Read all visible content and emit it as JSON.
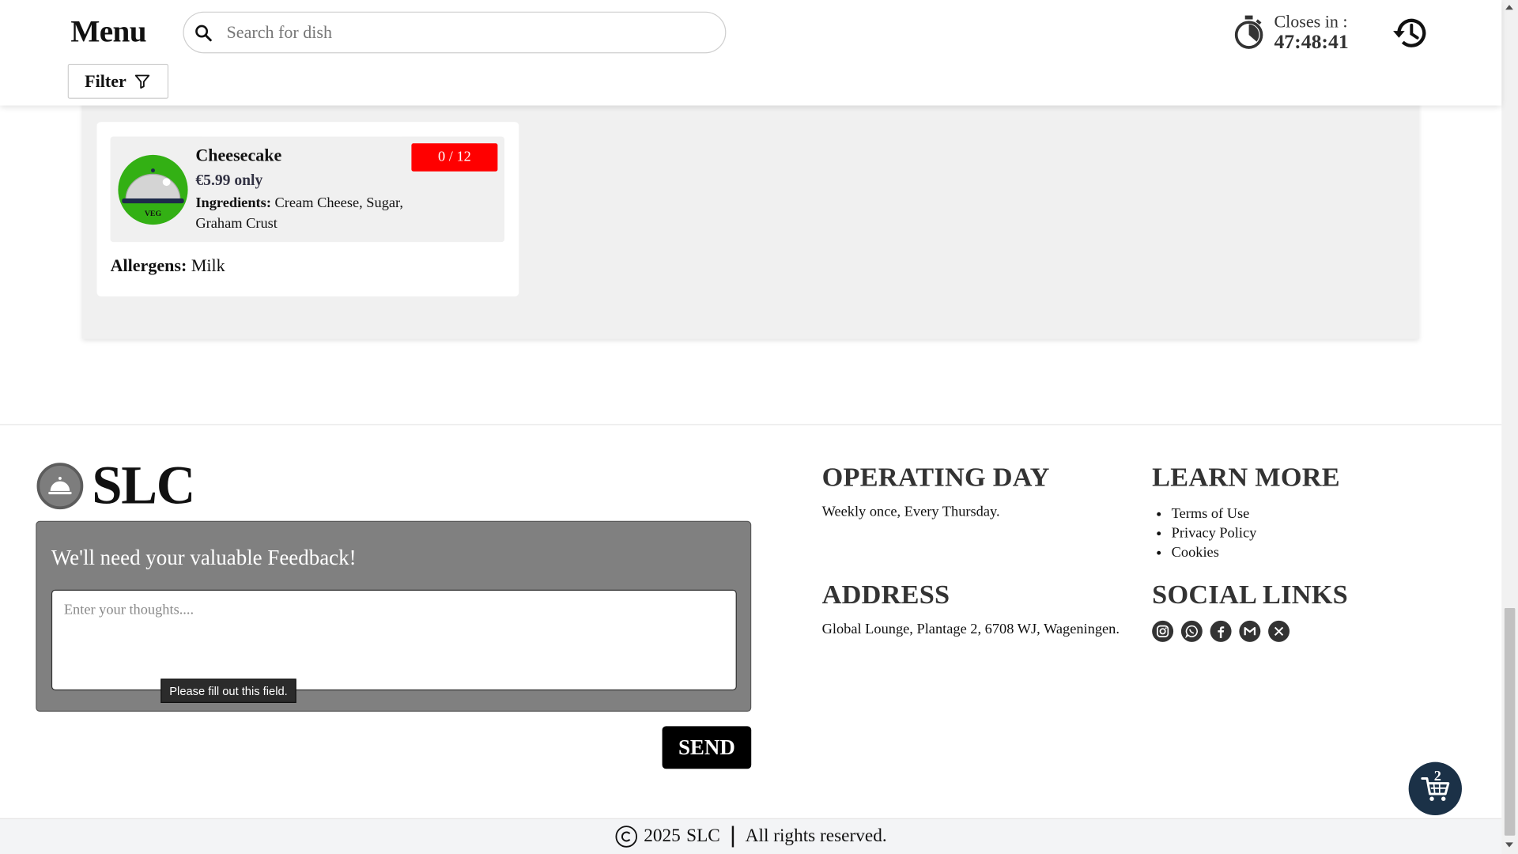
{
  "header": {
    "title": "Menu",
    "search_placeholder": "Search for dish",
    "filter_label": "Filter",
    "timer_label": "Closes in :",
    "timer_value": "47:48:41"
  },
  "dish": {
    "name": "Cheesecake",
    "price": "€5.99 only",
    "ingredients_label": "Ingredients:",
    "ingredients": "Cream Cheese, Sugar, Graham Crust",
    "veg_label": "VEG",
    "quantity": "0 / 12",
    "allergens_label": "Allergens:",
    "allergens": "Milk"
  },
  "footer": {
    "brand": "SLC",
    "feedback_title": "We'll need your valuable Feedback!",
    "feedback_placeholder": "Enter your thoughts....",
    "validation_tooltip": "Please fill out this field.",
    "send_label": "SEND",
    "operating_heading": "OPERATING DAY",
    "operating_text": "Weekly once, Every Thursday.",
    "learn_heading": "LEARN MORE",
    "learn_links": [
      "Terms of Use",
      "Privacy Policy",
      "Cookies"
    ],
    "address_heading": "ADDRESS",
    "address_text": "Global Lounge, Plantage 2, 6708 WJ, Wageningen.",
    "social_heading": "SOCIAL LINKS",
    "social_icons": [
      "instagram-icon",
      "whatsapp-icon",
      "facebook-icon",
      "gmail-icon",
      "x-icon"
    ],
    "cart_count": "2",
    "copyright_year": "2025",
    "copyright_brand": "SLC",
    "copyright_text": "All rights reserved."
  },
  "colors": {
    "veg_badge": "#33b014",
    "quantity_badge": "#ff0000",
    "cart_button": "#1b3147",
    "feedback_panel": "#808080"
  }
}
